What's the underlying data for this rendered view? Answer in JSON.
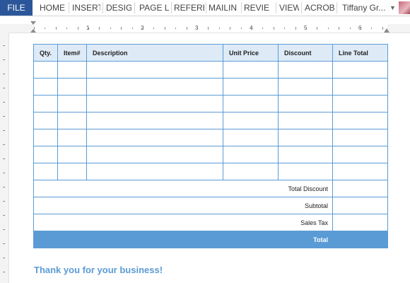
{
  "ribbon": {
    "file_label": "FILE",
    "tabs": [
      "HOME",
      "INSERT",
      "DESIG",
      "PAGE L",
      "REFERE",
      "MAILIN",
      "REVIE",
      "VIEW",
      "ACROB"
    ],
    "user_name": "Tiffany Gr...",
    "file_color": "#2b579a"
  },
  "ruler": {
    "numbers": [
      "1",
      "2",
      "3",
      "4",
      "5",
      "6"
    ]
  },
  "table": {
    "headers": [
      "Qty.",
      "Item#",
      "Description",
      "Unit Price",
      "Discount",
      "Line Total"
    ],
    "empty_rows": 7,
    "summary": {
      "total_discount": "Total Discount",
      "subtotal": "Subtotal",
      "sales_tax": "Sales Tax",
      "total": "Total"
    },
    "accent": "#5b9bd5",
    "header_fill": "#deebf7"
  },
  "footer": {
    "thanks": "Thank you for your business!"
  }
}
